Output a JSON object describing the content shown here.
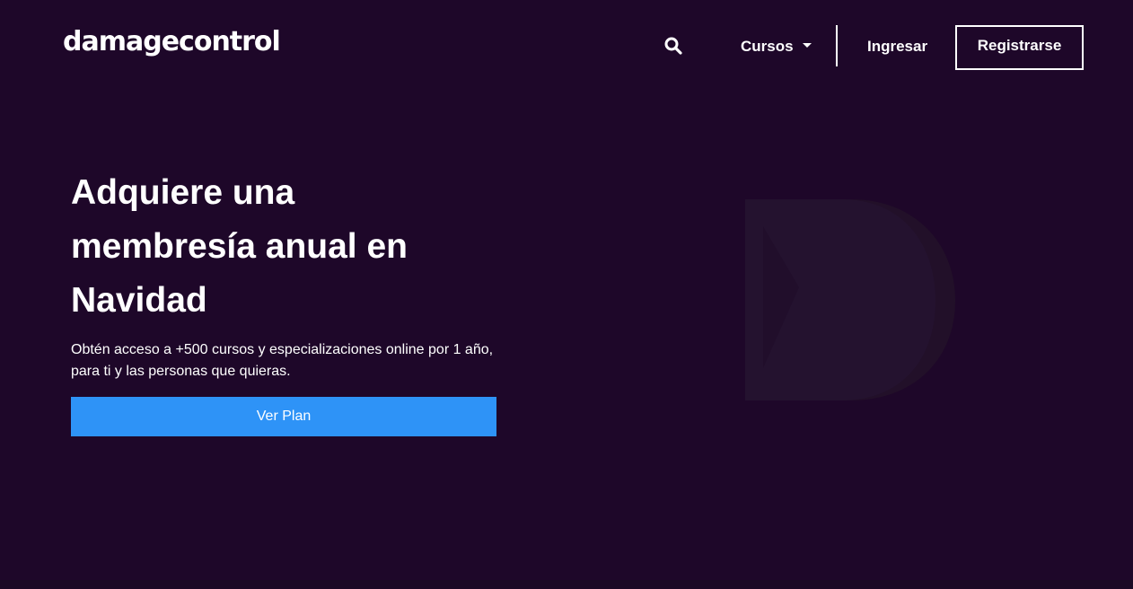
{
  "header": {
    "logo_text": "damagecontrol",
    "nav": {
      "search_icon": "search-icon",
      "cursos_label": "Cursos",
      "cursos_caret_icon": "caret-down-icon",
      "ingresar_label": "Ingresar",
      "registrarse_label": "Registrarse"
    }
  },
  "hero": {
    "title_line1": "Adquiere una",
    "title_line2": "membresía anual en",
    "title_line3": "Navidad",
    "subtitle_line1": "Obtén acceso a +500 cursos y especializaciones online por 1 año,",
    "subtitle_line2": "para ti y las personas que quieras.",
    "cta_label": "Ver Plan",
    "graphic": "brand-d-mark"
  },
  "colors": {
    "background": "#1e0729",
    "accent": "#2e93f7",
    "text": "#ffffff",
    "graphic_fill": "#24122f"
  }
}
